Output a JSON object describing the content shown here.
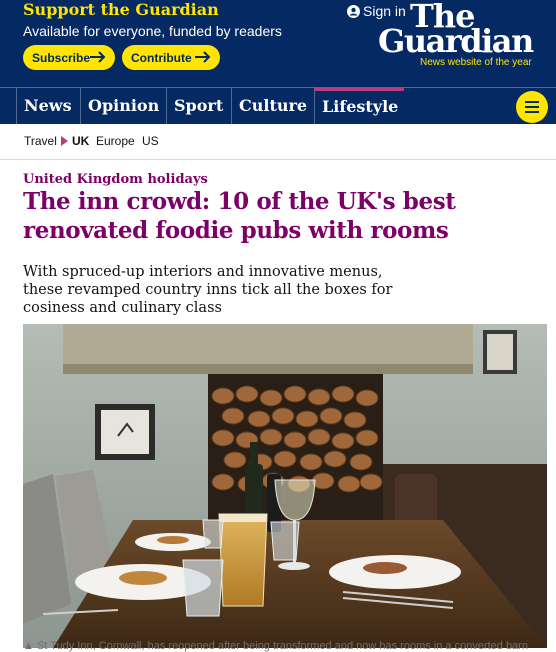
{
  "header": {
    "support_title": "Support the Guardian",
    "support_sub": "Available for everyone, funded by readers",
    "subscribe_label": "Subscribe",
    "contribute_label": "Contribute",
    "sign_in_label": "Sign in",
    "logo_the": "The",
    "logo_guardian": "Guardian",
    "logo_tagline": "News website of the year"
  },
  "nav": {
    "items": [
      {
        "label": "News"
      },
      {
        "label": "Opinion"
      },
      {
        "label": "Sport"
      },
      {
        "label": "Culture"
      },
      {
        "label": "Lifestyle",
        "active": true
      }
    ],
    "menu_icon": "hamburger-menu-icon"
  },
  "subnav": {
    "section": "Travel",
    "items": [
      "UK",
      "Europe",
      "US"
    ],
    "active": "UK"
  },
  "article": {
    "kicker": "United Kingdom holidays",
    "headline": "The inn crowd: 10 of the UK's best renovated foodie pubs with rooms",
    "standfirst": "With spruced-up interiors and innovative menus, these revamped country inns tick all the boxes for cosiness and culinary class",
    "image_alt": "Pub dining table with pint of beer, wine glass and plates of food in front of a log-filled fireplace",
    "caption": "St Tudy Inn, Cornwall, has reopened after being transformed and now has rooms in a converted barn"
  },
  "colors": {
    "brand_blue": "#052962",
    "accent_yellow": "#ffe500",
    "lifestyle_purple": "#7d0068",
    "lifestyle_pink": "#bb3b80"
  }
}
